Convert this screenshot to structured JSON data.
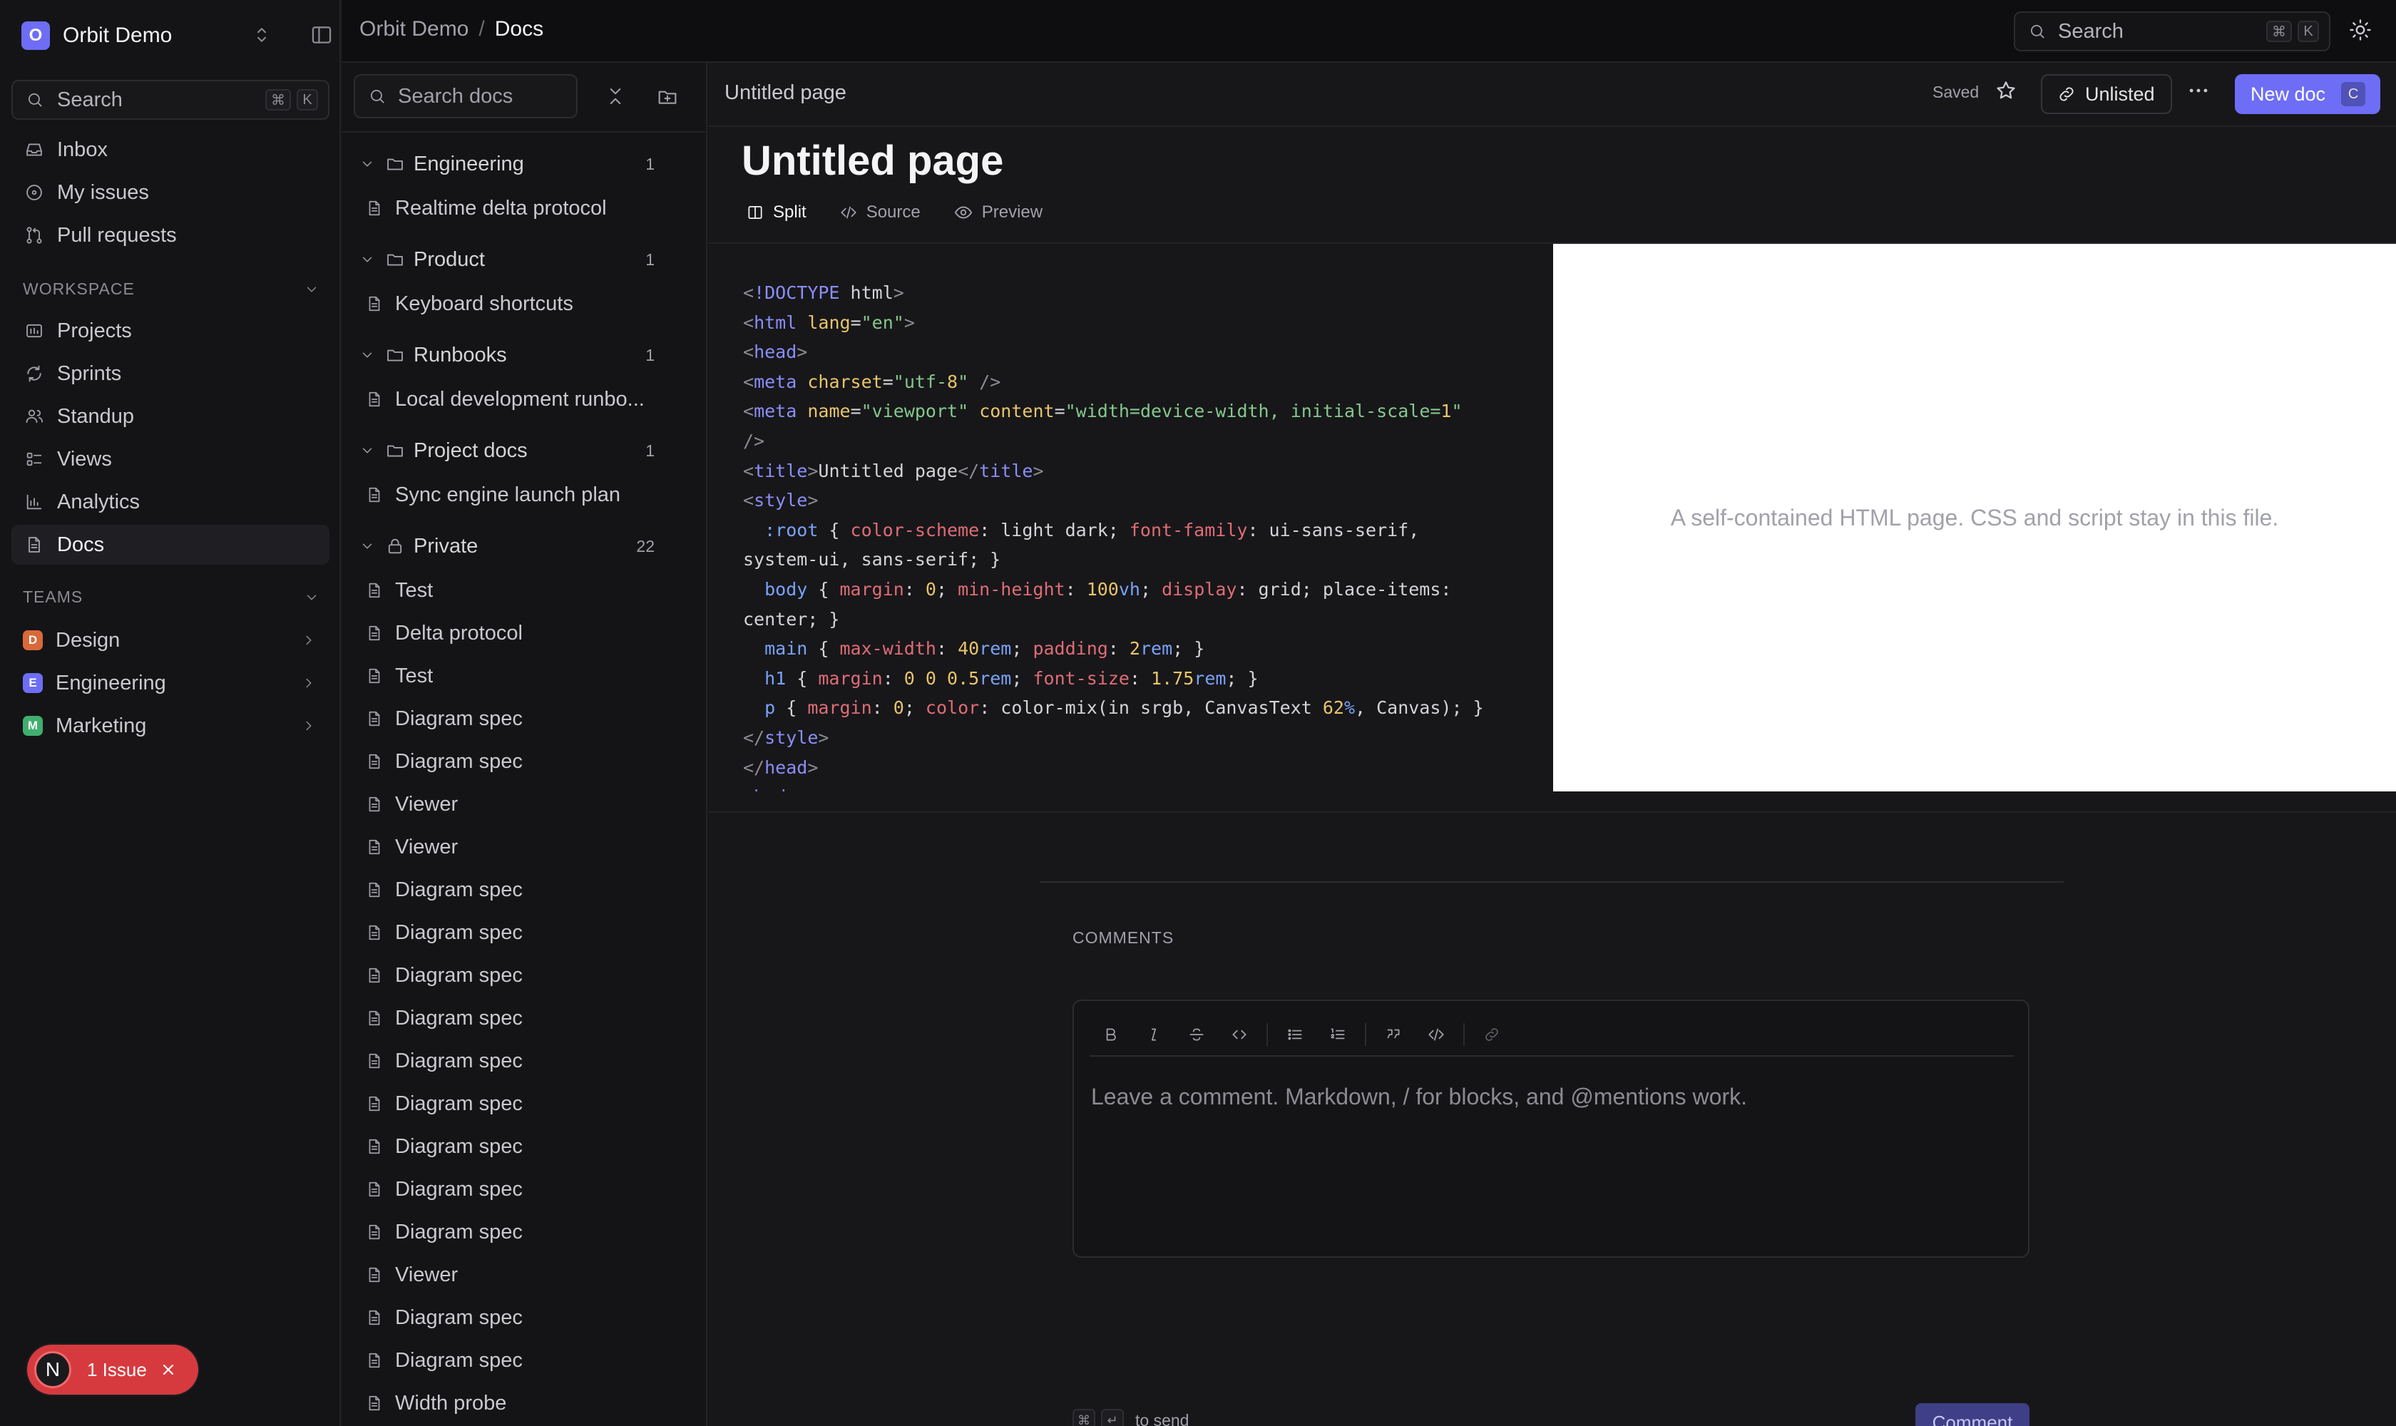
{
  "workspace": {
    "badge": "O",
    "name": "Orbit Demo"
  },
  "sidebar": {
    "search_label": "Search",
    "search_kbd": [
      "⌘",
      "K"
    ],
    "primary": [
      {
        "label": "Inbox",
        "icon": "inbox-icon"
      },
      {
        "label": "My issues",
        "icon": "circle-dot-icon"
      },
      {
        "label": "Pull requests",
        "icon": "git-pull-request-icon"
      }
    ],
    "workspace_heading": "WORKSPACE",
    "workspace_items": [
      {
        "label": "Projects",
        "icon": "projects-icon"
      },
      {
        "label": "Sprints",
        "icon": "refresh-icon"
      },
      {
        "label": "Standup",
        "icon": "users-icon"
      },
      {
        "label": "Views",
        "icon": "list-icon"
      },
      {
        "label": "Analytics",
        "icon": "bar-chart-icon"
      },
      {
        "label": "Docs",
        "icon": "document-icon",
        "active": true
      }
    ],
    "teams_heading": "TEAMS",
    "teams": [
      {
        "badge": "D",
        "label": "Design",
        "color": "#d9693a"
      },
      {
        "badge": "E",
        "label": "Engineering",
        "color": "#6d6ef5"
      },
      {
        "badge": "M",
        "label": "Marketing",
        "color": "#3fae6e"
      }
    ],
    "issue_pill": {
      "avatar": "N",
      "label": "1 Issue"
    }
  },
  "topbar": {
    "breadcrumb": [
      "Orbit Demo",
      "Docs"
    ],
    "separator": "/",
    "search_label": "Search",
    "search_kbd": [
      "⌘",
      "K"
    ]
  },
  "docs_panel": {
    "search_placeholder": "Search docs",
    "folders": [
      {
        "label": "Engineering",
        "count": "1",
        "docs": [
          "Realtime delta protocol"
        ]
      },
      {
        "label": "Product",
        "count": "1",
        "docs": [
          "Keyboard shortcuts"
        ]
      },
      {
        "label": "Runbooks",
        "count": "1",
        "docs": [
          "Local development runbo..."
        ]
      },
      {
        "label": "Project docs",
        "count": "1",
        "docs": [
          "Sync engine launch plan"
        ]
      }
    ],
    "private": {
      "label": "Private",
      "count": "22",
      "docs": [
        "Test",
        "Delta protocol",
        "Test",
        "Diagram spec",
        "Diagram spec",
        "Viewer",
        "Viewer",
        "Diagram spec",
        "Diagram spec",
        "Diagram spec",
        "Diagram spec",
        "Diagram spec",
        "Diagram spec",
        "Diagram spec",
        "Diagram spec",
        "Diagram spec",
        "Viewer",
        "Diagram spec",
        "Diagram spec",
        "Width probe"
      ]
    }
  },
  "doc": {
    "crumb": "Untitled page",
    "saved": "Saved",
    "visibility": "Unlisted",
    "new_doc": "New doc",
    "new_doc_kbd": "C",
    "title": "Untitled page",
    "modes": [
      {
        "label": "Split",
        "icon": "split-icon",
        "active": true
      },
      {
        "label": "Source",
        "icon": "code-icon"
      },
      {
        "label": "Preview",
        "icon": "eye-icon"
      }
    ],
    "code_lines": [
      "<!DOCTYPE html>",
      "<html lang=\"en\">",
      "<head>",
      "<meta charset=\"utf-8\" />",
      "<meta name=\"viewport\" content=\"width=device-width, initial-scale=1\"",
      "/>",
      "<title>Untitled page</title>",
      "<style>",
      "  :root { color-scheme: light dark; font-family: ui-sans-serif,",
      "system-ui, sans-serif; }",
      "  body { margin: 0; min-height: 100vh; display: grid; place-items:",
      "center; }",
      "  main { max-width: 40rem; padding: 2rem; }",
      "  h1 { margin: 0 0 0.5rem; font-size: 1.75rem; }",
      "  p { margin: 0; color: color-mix(in srgb, CanvasText 62%, Canvas); }",
      "</style>",
      "</head>",
      "<body>"
    ],
    "preview_text": "A self-contained HTML page. CSS and script stay in this file."
  },
  "comments": {
    "heading": "COMMENTS",
    "placeholder": "Leave a comment. Markdown, / for blocks, and @mentions work.",
    "send_keys": [
      "⌘",
      "↵"
    ],
    "send_hint": "to send",
    "button": "Comment",
    "toolbar": [
      "bold-icon",
      "italic-icon",
      "strikethrough-icon",
      "inline-code-icon",
      "bullet-list-icon",
      "numbered-list-icon",
      "quote-icon",
      "code-block-icon",
      "link-icon"
    ]
  }
}
